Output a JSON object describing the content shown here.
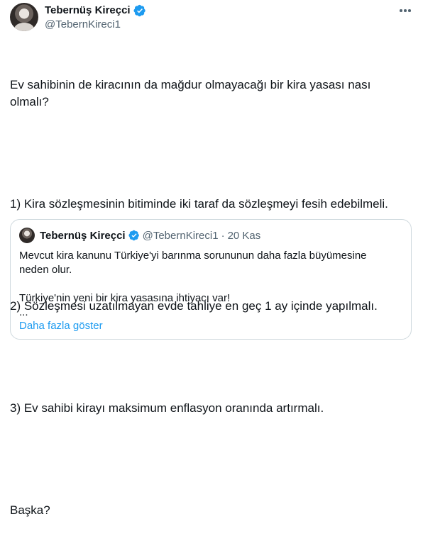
{
  "author": {
    "display_name": "Tebernüş Kireçci",
    "handle": "@TebernKireci1",
    "verified": true
  },
  "more_icon": "ellipsis-icon",
  "tweet": {
    "lines": [
      "Ev sahibinin de kiracının da mağdur olmayacağı bir kira yasası nası olmalı?",
      "1) Kira sözleşmesinin bitiminde iki taraf da sözleşmeyi fesih edebilmeli.",
      "2) Sözleşmesi uzatılmayan evde tahliye en geç 1 ay içinde yapılmalı.",
      "3) Ev sahibi kirayı maksimum enflasyon oranında artırmalı.",
      "Başka?"
    ]
  },
  "quote": {
    "display_name": "Tebernüş Kireçci",
    "handle": "@TebernKireci1",
    "separator": "·",
    "date": "20 Kas",
    "text_lines": [
      "Mevcut kira kanunu Türkiye'yi barınma sorununun daha fazla büyümesine neden olur.",
      "Türkiye'nin yeni bir kira yasasına ihtiyacı var!",
      "..."
    ],
    "show_more": "Daha fazla göster"
  },
  "colors": {
    "verified_blue": "#1d9bf0",
    "link_blue": "#1d9bf0",
    "secondary_text": "#536471",
    "border": "#cfd9de"
  }
}
